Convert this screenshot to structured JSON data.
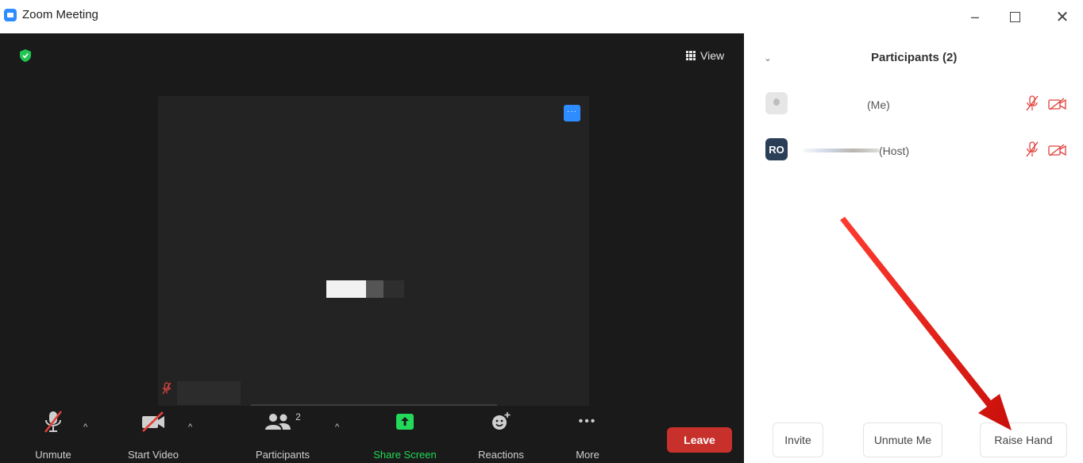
{
  "window": {
    "title": "Zoom Meeting",
    "minimize": "–",
    "close": "✕"
  },
  "meeting": {
    "view_label": "View",
    "tile_more": "···",
    "toolbar": {
      "unmute": "Unmute",
      "start_video": "Start Video",
      "participants": "Participants",
      "participants_count": "2",
      "share_screen": "Share Screen",
      "reactions": "Reactions",
      "more": "More",
      "more_dots": "•••",
      "leave": "Leave"
    }
  },
  "participants_panel": {
    "title": "Participants (2)",
    "rows": [
      {
        "label": "(Me)"
      },
      {
        "initials": "RO",
        "label": "(Host)"
      }
    ],
    "footer": {
      "invite": "Invite",
      "unmute_me": "Unmute Me",
      "raise_hand": "Raise Hand"
    }
  },
  "colors": {
    "meeting_bg": "#1a1a1a",
    "tile_bg": "#232323",
    "accent_blue": "#2d8cff",
    "leave_red": "#c8302b",
    "share_green": "#23d959",
    "muted_red": "#e0403a",
    "avatar_navy": "#2b3e58",
    "arrow_red": "#e8241c"
  },
  "icons": [
    "app-icon",
    "shield-icon",
    "grid-icon",
    "mic-muted-icon",
    "video-off-icon",
    "participants-icon",
    "share-screen-icon",
    "reactions-icon",
    "more-icon",
    "chevron-down-icon",
    "caret-up-icon",
    "camera-off-icon"
  ]
}
